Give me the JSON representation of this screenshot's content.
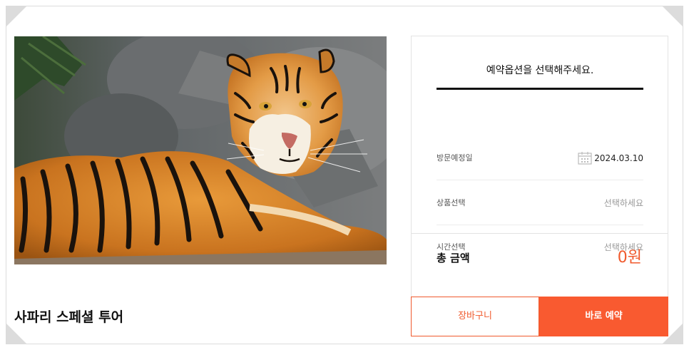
{
  "product": {
    "title": "사파리 스페셜 투어",
    "image_subject": "tiger"
  },
  "booking": {
    "heading": "예약옵션을 선택해주세요.",
    "visit_date_label": "방문예정일",
    "visit_date_value": "2024.03.10",
    "product_label": "상품선택",
    "product_placeholder": "선택하세요",
    "time_label": "시간선택",
    "time_placeholder": "선택하세요",
    "total_label": "총 금액",
    "total_amount": "0원"
  },
  "actions": {
    "cart_label": "장바구니",
    "book_label": "바로 예약"
  },
  "colors": {
    "accent": "#f95a30",
    "accent_text": "#f05a2d"
  },
  "icons": {
    "calendar": "calendar-icon"
  }
}
